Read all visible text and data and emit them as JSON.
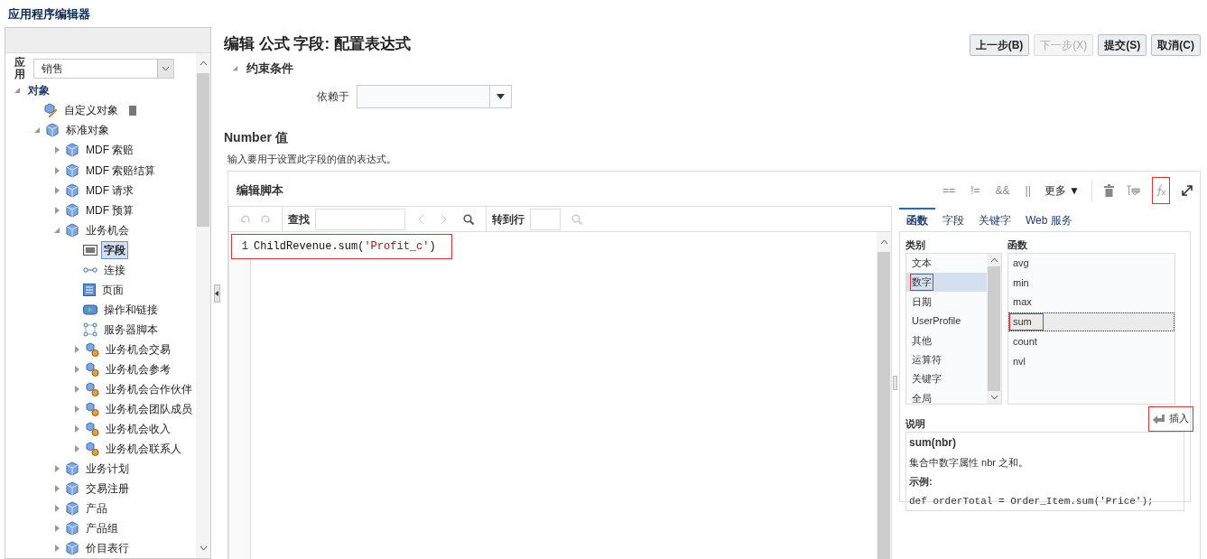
{
  "app_title": "应用程序编辑器",
  "sidebar": {
    "app_label": "应用",
    "app_value": "销售",
    "tree": [
      {
        "label": "对象",
        "kind": "none",
        "expanded": true,
        "selected": false,
        "children": [
          {
            "label": "自定义对象",
            "kind": "custom",
            "selected": false
          },
          {
            "label": "标准对象",
            "kind": "cube",
            "expanded": true,
            "selected": false,
            "children": [
              {
                "label": "MDF 索赔",
                "kind": "cube",
                "expanded": false,
                "selected": false
              },
              {
                "label": "MDF 索赔结算",
                "kind": "cube",
                "expanded": false,
                "selected": false
              },
              {
                "label": "MDF 请求",
                "kind": "cube",
                "expanded": false,
                "selected": false
              },
              {
                "label": "MDF 预算",
                "kind": "cube",
                "expanded": false,
                "selected": false
              },
              {
                "label": "业务机会",
                "kind": "cube",
                "expanded": true,
                "selected": false,
                "children": [
                  {
                    "label": "字段",
                    "kind": "field",
                    "selected": true
                  },
                  {
                    "label": "连接",
                    "kind": "link",
                    "selected": false
                  },
                  {
                    "label": "页面",
                    "kind": "page",
                    "selected": false
                  },
                  {
                    "label": "操作和链接",
                    "kind": "action",
                    "selected": false
                  },
                  {
                    "label": "服务器脚本",
                    "kind": "script",
                    "selected": false
                  },
                  {
                    "label": "业务机会交易",
                    "kind": "relation",
                    "expanded": false,
                    "selected": false
                  },
                  {
                    "label": "业务机会参考",
                    "kind": "relation",
                    "expanded": false,
                    "selected": false
                  },
                  {
                    "label": "业务机会合作伙伴",
                    "kind": "relation",
                    "expanded": false,
                    "selected": false
                  },
                  {
                    "label": "业务机会团队成员",
                    "kind": "relation",
                    "expanded": false,
                    "selected": false
                  },
                  {
                    "label": "业务机会收入",
                    "kind": "relation",
                    "expanded": false,
                    "selected": false
                  },
                  {
                    "label": "业务机会联系人",
                    "kind": "relation",
                    "expanded": false,
                    "selected": false
                  }
                ]
              },
              {
                "label": "业务计划",
                "kind": "cube",
                "expanded": false,
                "selected": false
              },
              {
                "label": "交易注册",
                "kind": "cube",
                "expanded": false,
                "selected": false
              },
              {
                "label": "产品",
                "kind": "cube",
                "expanded": false,
                "selected": false
              },
              {
                "label": "产品组",
                "kind": "cube",
                "expanded": false,
                "selected": false
              },
              {
                "label": "价目表行",
                "kind": "cube",
                "expanded": false,
                "selected": false
              }
            ]
          }
        ]
      }
    ]
  },
  "page_title": "编辑 公式 字段: 配置表达式",
  "buttons": [
    {
      "label": "上一步(B)",
      "disabled": false
    },
    {
      "label": "下一步(X)",
      "disabled": true
    },
    {
      "label": "提交(S)",
      "disabled": false
    },
    {
      "label": "取消(C)",
      "disabled": false
    }
  ],
  "constraints": {
    "title": "约束条件",
    "expanded": true,
    "depends_label": "依赖于"
  },
  "value_section": {
    "title": "Number 值",
    "hint": "输入要用于设置此字段的值的表达式。"
  },
  "editor": {
    "title": "编辑脚本",
    "operators": [
      "==",
      "!=",
      "&&",
      "||"
    ],
    "more": "更多 ▼",
    "fx_annotated": true,
    "find_label": "查找",
    "goto_label": "转到行",
    "lines": [
      {
        "number": "1",
        "annotated": true,
        "tokens": [
          {
            "kind": "plain",
            "text": "ChildRevenue.sum("
          },
          {
            "kind": "string",
            "text": "'Profit_c'"
          },
          {
            "kind": "plain",
            "text": ")"
          }
        ]
      }
    ]
  },
  "palette": {
    "tabs": [
      {
        "label": "函数",
        "selected": true
      },
      {
        "label": "字段",
        "selected": false
      },
      {
        "label": "关键字",
        "selected": false
      },
      {
        "label": "Web 服务",
        "selected": false
      }
    ],
    "categories_label": "类别",
    "functions_label": "函数",
    "categories": [
      {
        "label": "文本",
        "selected": false,
        "annotated": false
      },
      {
        "label": "数字",
        "selected": true,
        "annotated": true
      },
      {
        "label": "日期",
        "selected": false,
        "annotated": false
      },
      {
        "label": "UserProfile",
        "selected": false,
        "annotated": false
      },
      {
        "label": "其他",
        "selected": false,
        "annotated": false
      },
      {
        "label": "运算符",
        "selected": false,
        "annotated": false
      },
      {
        "label": "关键字",
        "selected": false,
        "annotated": false
      },
      {
        "label": "全局",
        "selected": false,
        "annotated": false
      }
    ],
    "functions": [
      {
        "label": "avg",
        "selected": false,
        "annotated": false
      },
      {
        "label": "min",
        "selected": false,
        "annotated": false
      },
      {
        "label": "max",
        "selected": false,
        "annotated": false
      },
      {
        "label": "sum",
        "selected": true,
        "annotated": true
      },
      {
        "label": "count",
        "selected": false,
        "annotated": false
      },
      {
        "label": "nvl",
        "selected": false,
        "annotated": false
      }
    ],
    "description_label": "说明",
    "insert_label": "插入",
    "insert_annotated": true,
    "description": {
      "signature": "sum(nbr)",
      "text": "集合中数字属性 nbr 之和。",
      "example_label": "示例:",
      "example": "def orderTotal = Order_Item.sum('Price');"
    }
  }
}
